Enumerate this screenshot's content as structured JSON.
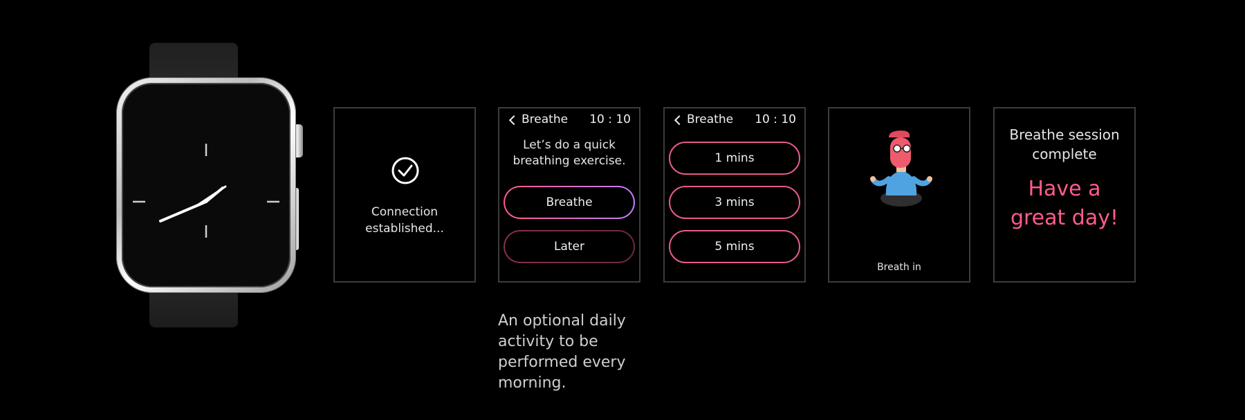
{
  "watch": {
    "icons": [
      "watch-case",
      "digital-crown",
      "analog-hands"
    ]
  },
  "screens": {
    "connection": {
      "icon": "check-circle-icon",
      "text": "Connection\nestablished..."
    },
    "prompt": {
      "back_label": "Breathe",
      "time": "10 : 10",
      "message": "Let’s do a quick\nbreathing exercise.",
      "primary_button": "Breathe",
      "secondary_button": "Later"
    },
    "duration": {
      "back_label": "Breathe",
      "time": "10 : 10",
      "options": [
        "1 mins",
        "3 mins",
        "5 mins"
      ]
    },
    "breathing": {
      "illustration": "meditating-person",
      "label": "Breath in"
    },
    "complete": {
      "title": "Breathe session\ncomplete",
      "greeting": "Have a\ngreat day!"
    }
  },
  "caption": "An optional daily\nactivity to be\nperformed every\nmorning.",
  "colors": {
    "background": "#000000",
    "accent_pink": "#ff5c8a",
    "accent_purple": "#c57cff",
    "frame": "#3c3c3c"
  }
}
